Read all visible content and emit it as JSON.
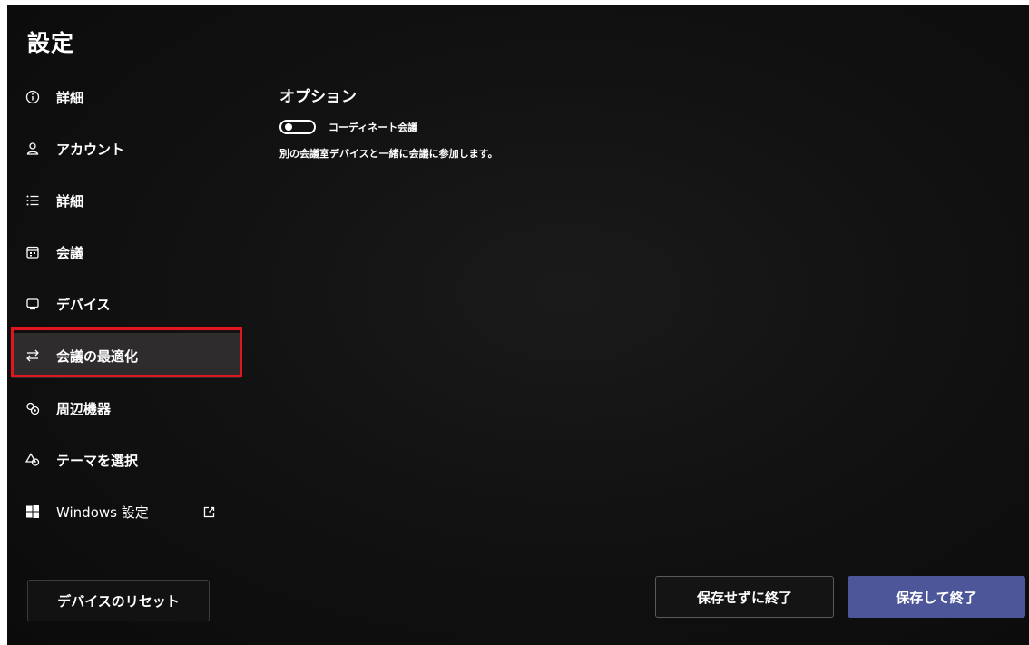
{
  "window": {
    "title": "設定"
  },
  "sidebar": {
    "items": [
      {
        "label": "詳細",
        "icon": "info-icon",
        "selected": false
      },
      {
        "label": "アカウント",
        "icon": "person-icon",
        "selected": false
      },
      {
        "label": "詳細",
        "icon": "list-icon",
        "selected": false
      },
      {
        "label": "会議",
        "icon": "calendar-icon",
        "selected": false
      },
      {
        "label": "デバイス",
        "icon": "device-icon",
        "selected": false
      },
      {
        "label": "会議の最適化",
        "icon": "switch-arrows-icon",
        "selected": true
      },
      {
        "label": "周辺機器",
        "icon": "peripherals-icon",
        "selected": false
      },
      {
        "label": "テーマを選択",
        "icon": "theme-shapes-icon",
        "selected": false
      },
      {
        "label": "Windows 設定",
        "icon": "windows-logo-icon",
        "selected": false,
        "external_icon": "external-link-icon"
      }
    ]
  },
  "main": {
    "section_title": "オプション",
    "toggle": {
      "label": "コーディネート会議",
      "state": "off"
    },
    "description": "別の会議室デバイスと一緒に会議に参加します。"
  },
  "footer": {
    "reset_label": "デバイスのリセット",
    "discard_label": "保存せずに終了",
    "save_label": "保存して終了"
  },
  "colors": {
    "background": "#0b0b0b",
    "selected_item_bg": "#2e2c2c",
    "highlight_frame": "#e0151f",
    "primary_button": "#4c5698"
  }
}
